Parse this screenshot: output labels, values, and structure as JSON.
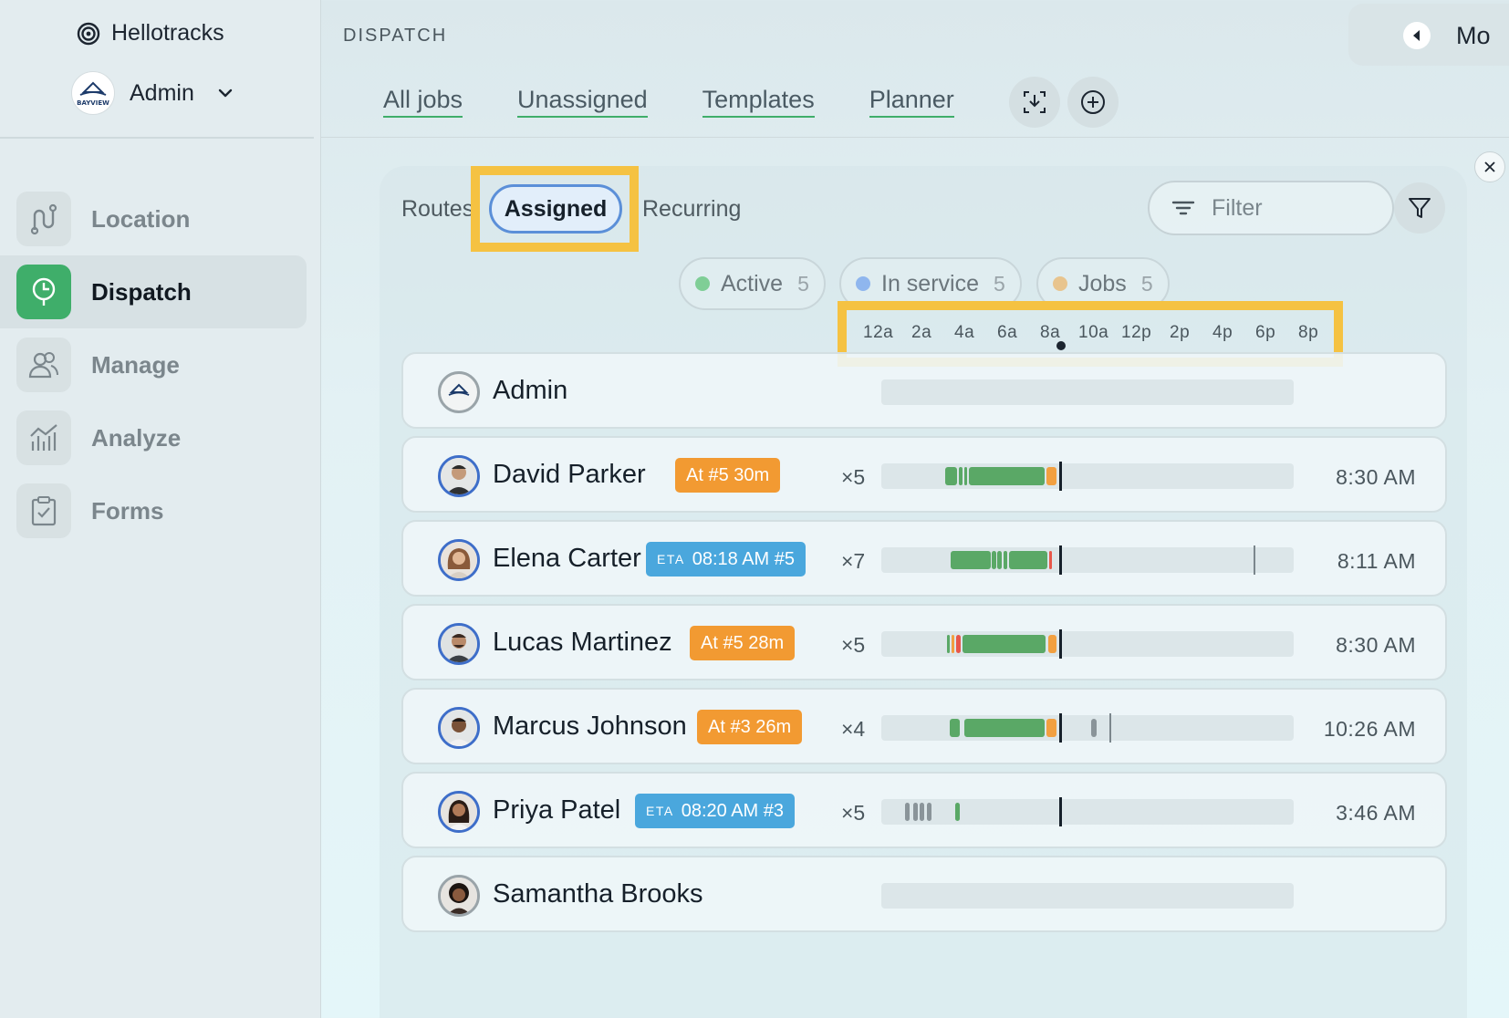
{
  "colors": {
    "accent_green": "#3fae6a",
    "highlight_yellow": "#f5c242",
    "badge_orange": "#f29a32",
    "badge_blue": "#4aa7dd",
    "bar_green": "#5aa866",
    "bar_orange": "#f2a040",
    "bar_red": "#e8574a",
    "bar_gray": "#8a9499"
  },
  "brand": {
    "name": "Hellotracks",
    "icon": "spiral-logo-icon"
  },
  "account": {
    "name": "Admin",
    "logo_text": "BAYVIEW"
  },
  "nav": [
    {
      "label": "Location",
      "icon": "route-icon"
    },
    {
      "label": "Dispatch",
      "icon": "dispatch-pin-icon",
      "active": true
    },
    {
      "label": "Manage",
      "icon": "users-icon"
    },
    {
      "label": "Analyze",
      "icon": "chart-icon"
    },
    {
      "label": "Forms",
      "icon": "clipboard-icon"
    }
  ],
  "header": {
    "section": "DISPATCH",
    "tabs": [
      "All jobs",
      "Unassigned",
      "Templates",
      "Planner"
    ],
    "mode_label": "Mo"
  },
  "panel": {
    "subtabs": {
      "routes": "Routes",
      "assigned": "Assigned",
      "recurring": "Recurring"
    },
    "filter_placeholder": "Filter",
    "chips": [
      {
        "label": "Active",
        "count": "5",
        "color": "#7fce96"
      },
      {
        "label": "In service",
        "count": "5",
        "color": "#8fb6ee"
      },
      {
        "label": "Jobs",
        "count": "5",
        "color": "#e8c48e"
      }
    ],
    "axis_ticks": [
      "12a",
      "2a",
      "4a",
      "6a",
      "8a",
      "10a",
      "12p",
      "2p",
      "4p",
      "6p",
      "8p"
    ]
  },
  "rows": [
    {
      "name": "Admin",
      "badge": null,
      "count": "",
      "time": "",
      "segments": []
    },
    {
      "name": "David Parker",
      "badge": {
        "kind": "orange",
        "pre": "",
        "text": "At #5 30m"
      },
      "count": "×5",
      "time": "8:30 AM",
      "segments": [
        [
          0.155,
          0.184,
          "g"
        ],
        [
          0.189,
          0.196,
          "g"
        ],
        [
          0.201,
          0.208,
          "g"
        ],
        [
          0.213,
          0.397,
          "g"
        ],
        [
          0.401,
          0.425,
          "o"
        ]
      ],
      "now": 0.431
    },
    {
      "name": "Elena Carter",
      "badge": {
        "kind": "blue",
        "pre": "ETA",
        "text": "08:18 AM #5"
      },
      "count": "×7",
      "time": "8:11 AM",
      "segments": [
        [
          0.168,
          0.265,
          "g"
        ],
        [
          0.268,
          0.278,
          "g"
        ],
        [
          0.282,
          0.292,
          "g"
        ],
        [
          0.296,
          0.306,
          "g"
        ],
        [
          0.309,
          0.402,
          "g"
        ],
        [
          0.406,
          0.413,
          "r"
        ]
      ],
      "now": 0.431,
      "end": 0.902
    },
    {
      "name": "Lucas Martinez",
      "badge": {
        "kind": "orange",
        "pre": "",
        "text": "At #5 28m"
      },
      "count": "×5",
      "time": "8:30 AM",
      "segments": [
        [
          0.159,
          0.166,
          "g"
        ],
        [
          0.17,
          0.177,
          "o"
        ],
        [
          0.181,
          0.193,
          "r"
        ],
        [
          0.197,
          0.399,
          "g"
        ],
        [
          0.404,
          0.425,
          "o"
        ]
      ],
      "now": 0.431
    },
    {
      "name": "Marcus Johnson",
      "badge": {
        "kind": "orange",
        "pre": "",
        "text": "At #3 26m"
      },
      "count": "×4",
      "time": "10:26 AM",
      "segments": [
        [
          0.166,
          0.19,
          "g"
        ],
        [
          0.201,
          0.396,
          "g"
        ],
        [
          0.401,
          0.425,
          "o"
        ],
        [
          0.509,
          0.522,
          "x"
        ]
      ],
      "now": 0.431,
      "end": 0.553
    },
    {
      "name": "Priya Patel",
      "badge": {
        "kind": "blue",
        "pre": "ETA",
        "text": "08:20 AM #3"
      },
      "count": "×5",
      "time": "3:46 AM",
      "segments": [
        [
          0.058,
          0.069,
          "x"
        ],
        [
          0.077,
          0.088,
          "x"
        ],
        [
          0.094,
          0.105,
          "x"
        ],
        [
          0.111,
          0.122,
          "x"
        ],
        [
          0.18,
          0.191,
          "g"
        ]
      ],
      "now": 0.431
    },
    {
      "name": "Samantha Brooks",
      "badge": null,
      "count": "",
      "time": "",
      "segments": []
    }
  ]
}
